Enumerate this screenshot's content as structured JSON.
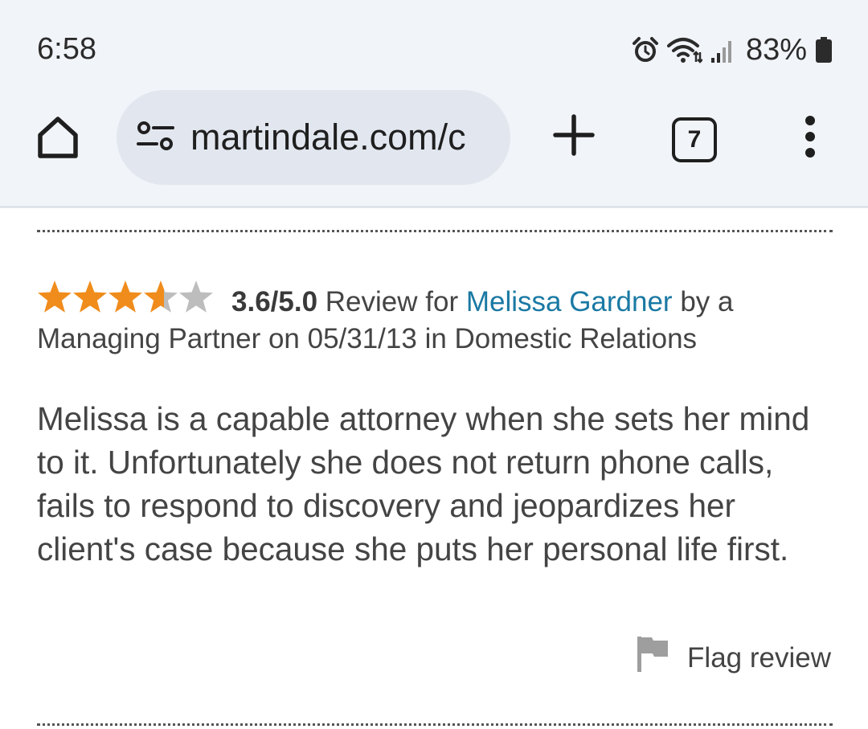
{
  "status_bar": {
    "time": "6:58",
    "battery_percent": "83%",
    "icons": [
      "alarm-icon",
      "wifi-icon",
      "signal-icon",
      "battery-icon"
    ]
  },
  "browser": {
    "url": "martindale.com/c",
    "tab_count": "7",
    "icons": [
      "home-icon",
      "tune-icon",
      "plus-icon",
      "more-vert-icon"
    ]
  },
  "review": {
    "rating": 3.6,
    "rating_max": 5,
    "rating_text": "3.6/5.0",
    "review_for_text": " Review for ",
    "lawyer_name": "Melissa Gardner",
    "byline_rest": " by a Managing Partner on 05/31/13 in Domestic Relations",
    "body": "Melissa is a capable attorney when she sets her mind to it. Unfortunately she does not return phone calls, fails to respond to discovery and jeopardizes her client's case because she puts her personal life first.",
    "flag_label": "Flag review"
  },
  "colors": {
    "star_filled": "#f08c1b",
    "star_empty": "#bdbdbd",
    "link": "#1a79a3",
    "chrome_bg": "#f1f4f9",
    "omnibox_bg": "#e2e7ef",
    "flag_icon": "#9e9e9e"
  }
}
